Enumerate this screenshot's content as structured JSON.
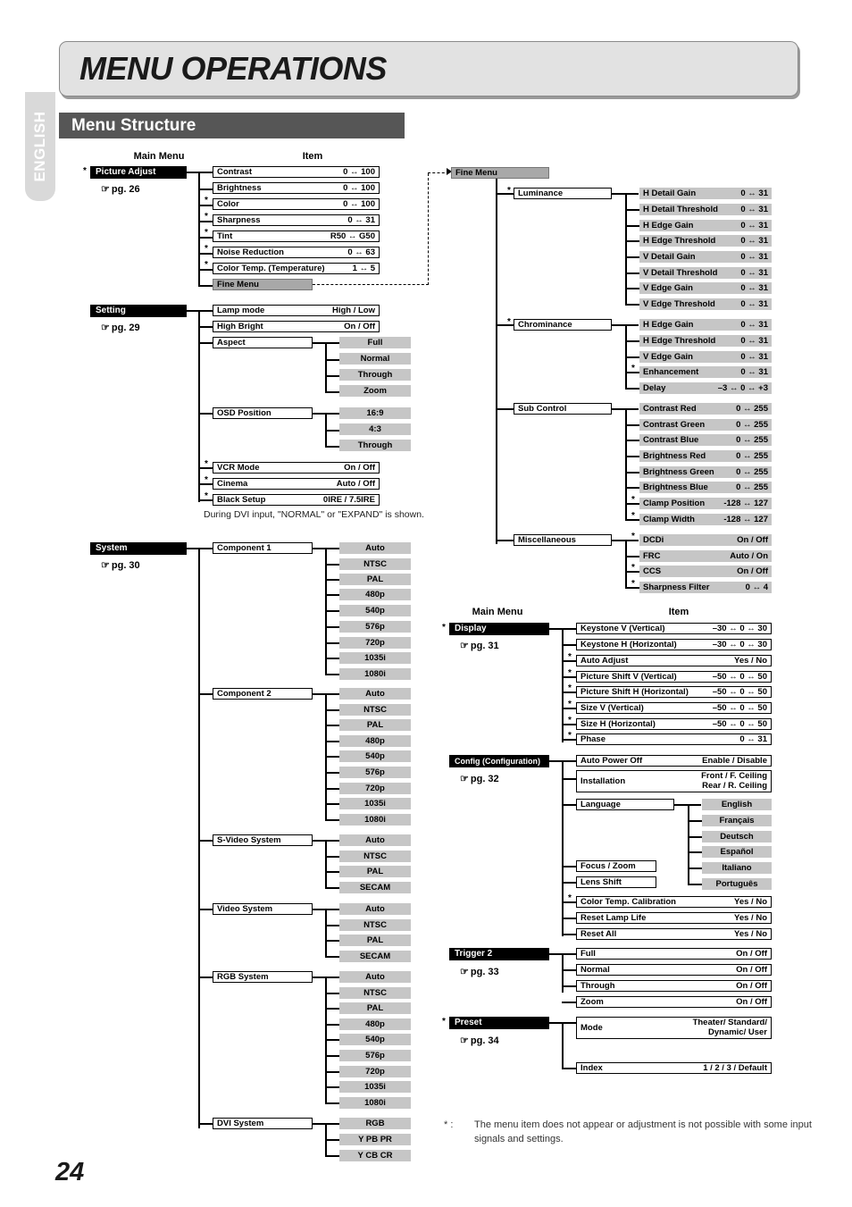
{
  "sidebar": {
    "language_tab": "ENGLISH"
  },
  "header": {
    "page_title": "MENU OPERATIONS",
    "section_title": "Menu Structure",
    "page_number": "24"
  },
  "column_headers": {
    "main_menu": "Main Menu",
    "item": "Item"
  },
  "notes": {
    "dvi_note": "During DVI input, \"NORMAL\" or \"EXPAND\" is shown.",
    "footnote_star": "* :",
    "footnote_text": "The menu item does not appear or adjustment is not possible with some input signals and settings."
  },
  "menus": {
    "picture_adjust": {
      "title": "Picture Adjust",
      "page_ref": "pg. 26",
      "starred": true,
      "items": [
        {
          "label": "Contrast",
          "value": "0   ↔ 100",
          "starred": false
        },
        {
          "label": "Brightness",
          "value": "0   ↔ 100",
          "starred": false
        },
        {
          "label": "Color",
          "value": "0   ↔ 100",
          "starred": true
        },
        {
          "label": "Sharpness",
          "value": "0   ↔  31",
          "starred": true
        },
        {
          "label": "Tint",
          "value": "R50 ↔ G50",
          "starred": true
        },
        {
          "label": "Noise Reduction",
          "value": "0   ↔  63",
          "starred": true
        },
        {
          "label": "Color Temp. (Temperature)",
          "value": "1   ↔   5",
          "starred": true
        },
        {
          "label": "Fine Menu",
          "value": "",
          "starred": false
        }
      ]
    },
    "setting": {
      "title": "Setting",
      "page_ref": "pg. 29",
      "starred": false,
      "items": [
        {
          "label": "Lamp mode",
          "value": "High / Low",
          "starred": false
        },
        {
          "label": "High Bright",
          "value": "On / Off",
          "starred": false
        },
        {
          "label": "Aspect",
          "value": "",
          "starred": false,
          "options": [
            "Full",
            "Normal",
            "Through",
            "Zoom"
          ]
        },
        {
          "label": "OSD Position",
          "value": "",
          "starred": false,
          "options": [
            "16:9",
            "4:3",
            "Through"
          ]
        },
        {
          "label": "VCR Mode",
          "value": "On / Off",
          "starred": true
        },
        {
          "label": "Cinema",
          "value": "Auto / Off",
          "starred": true
        },
        {
          "label": "Black Setup",
          "value": "0IRE / 7.5IRE",
          "starred": true
        }
      ]
    },
    "system": {
      "title": "System",
      "page_ref": "pg. 30",
      "starred": false,
      "groups": [
        {
          "label": "Component 1",
          "options": [
            "Auto",
            "NTSC",
            "PAL",
            "480p",
            "540p",
            "576p",
            "720p",
            "1035i",
            "1080i"
          ]
        },
        {
          "label": "Component 2",
          "options": [
            "Auto",
            "NTSC",
            "PAL",
            "480p",
            "540p",
            "576p",
            "720p",
            "1035i",
            "1080i"
          ]
        },
        {
          "label": "S-Video System",
          "options": [
            "Auto",
            "NTSC",
            "PAL",
            "SECAM"
          ]
        },
        {
          "label": "Video System",
          "options": [
            "Auto",
            "NTSC",
            "PAL",
            "SECAM"
          ]
        },
        {
          "label": "RGB System",
          "options": [
            "Auto",
            "NTSC",
            "PAL",
            "480p",
            "540p",
            "576p",
            "720p",
            "1035i",
            "1080i"
          ]
        },
        {
          "label": "DVI System",
          "options": [
            "RGB",
            "Y PB PR",
            "Y CB CR"
          ]
        }
      ]
    },
    "fine_menu": {
      "title": "Fine Menu",
      "groups": [
        {
          "label": "Luminance",
          "starred": true,
          "items": [
            {
              "label": "H Detail Gain",
              "value": "0   ↔  31"
            },
            {
              "label": "H Detail Threshold",
              "value": "0   ↔  31"
            },
            {
              "label": "H Edge Gain",
              "value": "0   ↔  31"
            },
            {
              "label": "H Edge Threshold",
              "value": "0   ↔  31"
            },
            {
              "label": "V Detail Gain",
              "value": "0   ↔  31"
            },
            {
              "label": "V Detail Threshold",
              "value": "0   ↔  31"
            },
            {
              "label": "V Edge Gain",
              "value": "0   ↔  31"
            },
            {
              "label": "V Edge Threshold",
              "value": "0   ↔  31"
            }
          ]
        },
        {
          "label": "Chrominance",
          "starred": true,
          "items": [
            {
              "label": "H Edge Gain",
              "value": "0   ↔  31"
            },
            {
              "label": "H Edge Threshold",
              "value": "0   ↔  31"
            },
            {
              "label": "V Edge Gain",
              "value": "0   ↔  31"
            },
            {
              "label": "Enhancement",
              "value": "0   ↔  31",
              "starred": true
            },
            {
              "label": "Delay",
              "value": "–3 ↔ 0 ↔ +3"
            }
          ]
        },
        {
          "label": "Sub Control",
          "starred": false,
          "items": [
            {
              "label": "Contrast Red",
              "value": "0   ↔ 255"
            },
            {
              "label": "Contrast Green",
              "value": "0   ↔ 255"
            },
            {
              "label": "Contrast Blue",
              "value": "0   ↔ 255"
            },
            {
              "label": "Brightness Red",
              "value": "0   ↔ 255"
            },
            {
              "label": "Brightness Green",
              "value": "0   ↔ 255"
            },
            {
              "label": "Brightness Blue",
              "value": "0   ↔ 255"
            },
            {
              "label": "Clamp Position",
              "value": "-128 ↔ 127",
              "starred": true
            },
            {
              "label": "Clamp Width",
              "value": "-128 ↔ 127",
              "starred": true
            }
          ]
        },
        {
          "label": "Miscellaneous",
          "starred": false,
          "items": [
            {
              "label": "DCDi",
              "value": "On / Off",
              "starred": true
            },
            {
              "label": "FRC",
              "value": "Auto / On"
            },
            {
              "label": "CCS",
              "value": "On / Off",
              "starred": true
            },
            {
              "label": "Sharpness Filter",
              "value": "0   ↔   4",
              "starred": true
            }
          ]
        }
      ]
    },
    "display": {
      "title": "Display",
      "page_ref": "pg. 31",
      "starred": true,
      "items": [
        {
          "label": "Keystone V (Vertical)",
          "value": "–30 ↔ 0 ↔ 30",
          "starred": false
        },
        {
          "label": "Keystone H (Horizontal)",
          "value": "–30 ↔ 0 ↔ 30",
          "starred": false
        },
        {
          "label": "Auto Adjust",
          "value": "Yes / No",
          "starred": true
        },
        {
          "label": "Picture Shift V (Vertical)",
          "value": "–50 ↔ 0 ↔ 50",
          "starred": true
        },
        {
          "label": "Picture Shift H (Horizontal)",
          "value": "–50 ↔ 0 ↔ 50",
          "starred": true
        },
        {
          "label": "Size V (Vertical)",
          "value": "–50 ↔ 0 ↔ 50",
          "starred": true
        },
        {
          "label": "Size H (Horizontal)",
          "value": "–50 ↔ 0 ↔ 50",
          "starred": true
        },
        {
          "label": "Phase",
          "value": "0   ↔  31",
          "starred": true
        }
      ]
    },
    "config": {
      "title": "Config (Configuration)",
      "page_ref": "pg. 32",
      "starred": false,
      "items": [
        {
          "label": "Auto Power Off",
          "value": "Enable / Disable",
          "starred": false
        },
        {
          "label": "Installation",
          "value": "Front / F. Ceiling\nRear / R. Ceiling",
          "starred": false
        },
        {
          "label": "Language",
          "value": "",
          "starred": false,
          "options": [
            "English",
            "Français",
            "Deutsch",
            "Español",
            "Italiano",
            "Português"
          ]
        },
        {
          "label": "Focus / Zoom",
          "value": "",
          "starred": false
        },
        {
          "label": "Lens Shift",
          "value": "",
          "starred": false
        },
        {
          "label": "Color Temp. Calibration",
          "value": "Yes / No",
          "starred": true
        },
        {
          "label": "Reset Lamp Life",
          "value": "Yes / No",
          "starred": false
        },
        {
          "label": "Reset All",
          "value": "Yes / No",
          "starred": false
        }
      ]
    },
    "trigger2": {
      "title": "Trigger 2",
      "page_ref": "pg. 33",
      "starred": false,
      "items": [
        {
          "label": "Full",
          "value": "On / Off"
        },
        {
          "label": "Normal",
          "value": "On / Off"
        },
        {
          "label": "Through",
          "value": "On / Off"
        },
        {
          "label": "Zoom",
          "value": "On / Off"
        }
      ]
    },
    "preset": {
      "title": "Preset",
      "page_ref": "pg. 34",
      "starred": true,
      "items": [
        {
          "label": "Mode",
          "value": "Theater/ Standard/\nDynamic/ User"
        },
        {
          "label": "Index",
          "value": "1 / 2 / 3 / Default"
        }
      ]
    }
  }
}
